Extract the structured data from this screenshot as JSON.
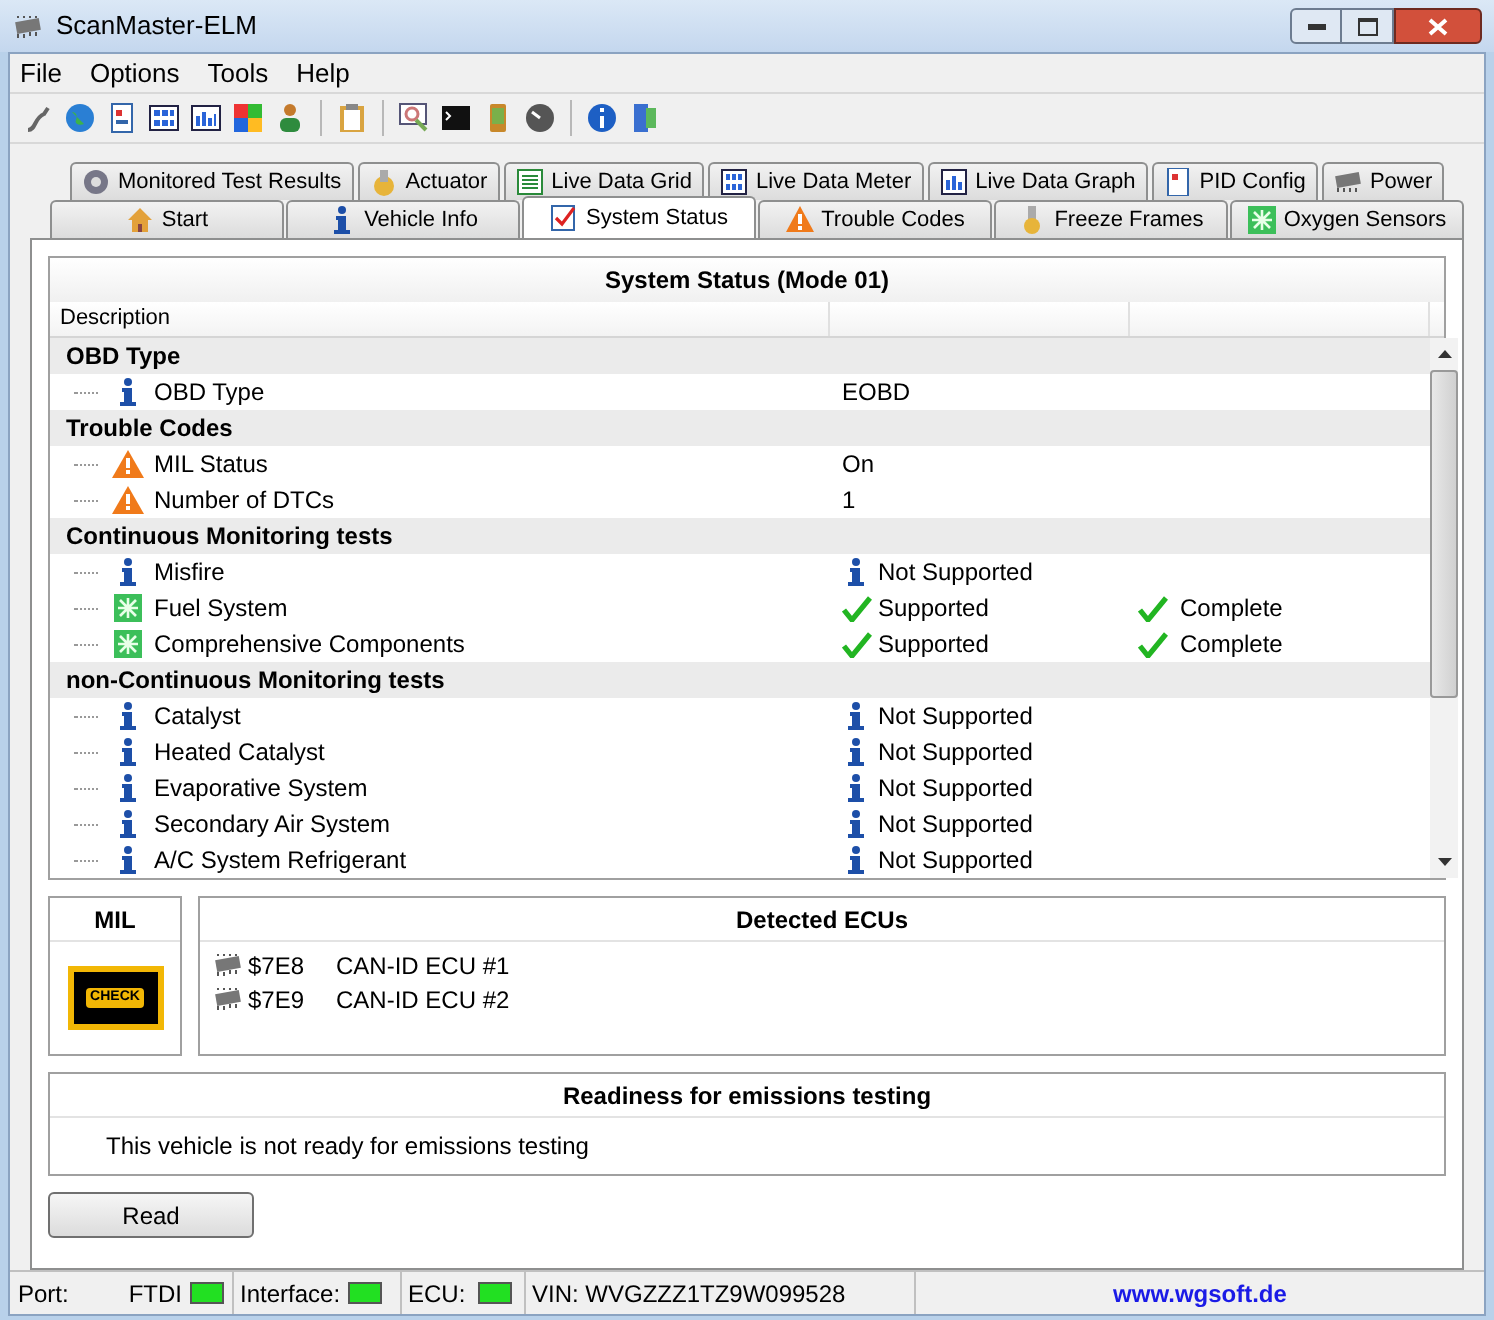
{
  "window": {
    "title": "ScanMaster-ELM"
  },
  "menu": [
    "File",
    "Options",
    "Tools",
    "Help"
  ],
  "tab_rows": [
    [
      {
        "label": "Monitored Test Results",
        "selected": false
      },
      {
        "label": "Actuator",
        "selected": false
      },
      {
        "label": "Live Data Grid",
        "selected": false
      },
      {
        "label": "Live Data Meter",
        "selected": false
      },
      {
        "label": "Live Data Graph",
        "selected": false
      },
      {
        "label": "PID Config",
        "selected": false
      },
      {
        "label": "Power",
        "selected": false
      }
    ],
    [
      {
        "label": "Start",
        "selected": false
      },
      {
        "label": "Vehicle Info",
        "selected": false
      },
      {
        "label": "System Status",
        "selected": true
      },
      {
        "label": "Trouble Codes",
        "selected": false
      },
      {
        "label": "Freeze Frames",
        "selected": false
      },
      {
        "label": "Oxygen Sensors",
        "selected": false
      }
    ]
  ],
  "table": {
    "title": "System Status (Mode 01)",
    "columns": [
      "Description"
    ],
    "groups": [
      {
        "label": "OBD Type",
        "rows": [
          {
            "kind": "info",
            "label": "OBD Type",
            "value": {
              "text": "EOBD"
            }
          }
        ]
      },
      {
        "label": "Trouble Codes",
        "rows": [
          {
            "kind": "warning",
            "label": "MIL Status",
            "value": {
              "text": "On"
            }
          },
          {
            "kind": "warning",
            "label": "Number of DTCs",
            "value": {
              "text": "1"
            }
          }
        ]
      },
      {
        "label": "Continuous Monitoring tests",
        "rows": [
          {
            "kind": "info",
            "label": "Misfire",
            "value": {
              "kind": "info",
              "text": "Not Supported"
            }
          },
          {
            "kind": "ok",
            "label": "Fuel System",
            "value": {
              "kind": "check",
              "text": "Supported"
            },
            "status": {
              "kind": "check",
              "text": "Complete"
            }
          },
          {
            "kind": "ok",
            "label": "Comprehensive Components",
            "value": {
              "kind": "check",
              "text": "Supported"
            },
            "status": {
              "kind": "check",
              "text": "Complete"
            }
          }
        ]
      },
      {
        "label": "non-Continuous Monitoring tests",
        "rows": [
          {
            "kind": "info",
            "label": "Catalyst",
            "value": {
              "kind": "info",
              "text": "Not Supported"
            }
          },
          {
            "kind": "info",
            "label": "Heated Catalyst",
            "value": {
              "kind": "info",
              "text": "Not Supported"
            }
          },
          {
            "kind": "info",
            "label": "Evaporative System",
            "value": {
              "kind": "info",
              "text": "Not Supported"
            }
          },
          {
            "kind": "info",
            "label": "Secondary Air System",
            "value": {
              "kind": "info",
              "text": "Not Supported"
            }
          },
          {
            "kind": "info",
            "label": "A/C System Refrigerant",
            "value": {
              "kind": "info",
              "text": "Not Supported"
            }
          }
        ]
      }
    ]
  },
  "mil": {
    "title": "MIL",
    "lamp_text": "CHECK",
    "on": true
  },
  "ecus": {
    "title": "Detected ECUs",
    "items": [
      {
        "id": "$7E8",
        "name": "CAN-ID ECU #1"
      },
      {
        "id": "$7E9",
        "name": "CAN-ID ECU #2"
      }
    ]
  },
  "readiness": {
    "title": "Readiness for emissions testing",
    "message": "This vehicle is not ready for emissions testing"
  },
  "read_button": "Read",
  "status_bar": {
    "port_label": "Port:",
    "port": "FTDI",
    "port_on": true,
    "interface_label": "Interface:",
    "interface_on": true,
    "ecu_label": "ECU:",
    "ecu_on": true,
    "vin": "VIN: WVGZZZ1TZ9W099528",
    "link": "www.wgsoft.de"
  }
}
